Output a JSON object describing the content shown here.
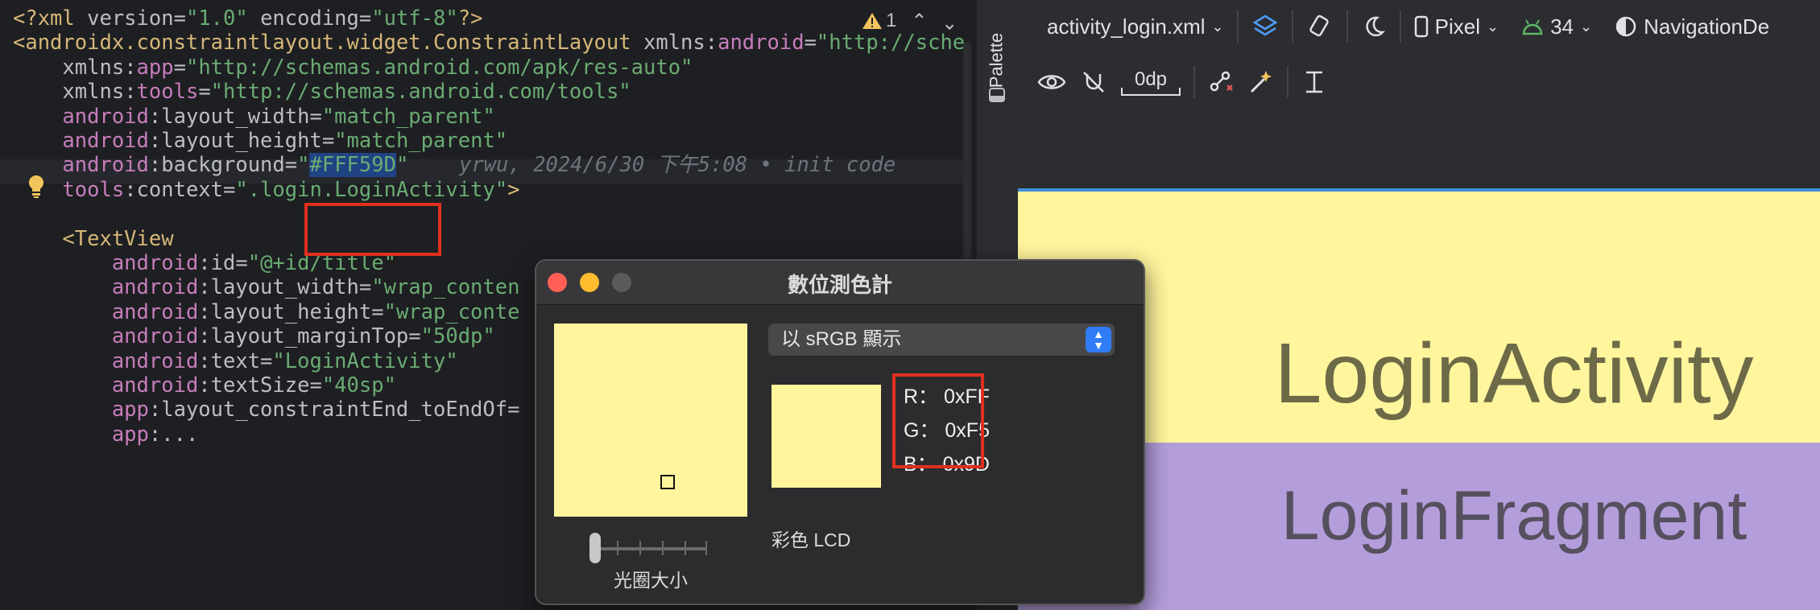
{
  "editor": {
    "lines": [
      {
        "parts": [
          [
            "tag",
            "<?xml "
          ],
          [
            "attr",
            "version"
          ],
          [
            "attr",
            "="
          ],
          [
            "str",
            "\"1.0\""
          ],
          [
            "attr",
            " encoding"
          ],
          [
            "attr",
            "="
          ],
          [
            "str",
            "\"utf-8\""
          ],
          [
            "tag",
            "?>"
          ]
        ]
      },
      {
        "parts": [
          [
            "tag",
            "<androidx.constraintlayout.widget.ConstraintLayout "
          ],
          [
            "attr",
            "xmlns"
          ],
          [
            "attr",
            ":"
          ],
          [
            "ns",
            "android"
          ],
          [
            "attr",
            "="
          ],
          [
            "str",
            "\"http://sche"
          ]
        ]
      },
      {
        "parts": [
          [
            "attr",
            "    "
          ],
          [
            "attr",
            "xmlns"
          ],
          [
            "attr",
            ":"
          ],
          [
            "ns",
            "app"
          ],
          [
            "attr",
            "="
          ],
          [
            "str",
            "\"http://schemas.android.com/apk/res-auto\""
          ]
        ]
      },
      {
        "parts": [
          [
            "attr",
            "    "
          ],
          [
            "attr",
            "xmlns"
          ],
          [
            "attr",
            ":"
          ],
          [
            "ns",
            "tools"
          ],
          [
            "attr",
            "="
          ],
          [
            "str",
            "\"http://schemas.android.com/tools\""
          ]
        ]
      },
      {
        "parts": [
          [
            "attr",
            "    "
          ],
          [
            "ns",
            "android"
          ],
          [
            "attr",
            ":layout_width="
          ],
          [
            "str",
            "\"match_parent\""
          ]
        ]
      },
      {
        "parts": [
          [
            "attr",
            "    "
          ],
          [
            "ns",
            "android"
          ],
          [
            "attr",
            ":layout_height="
          ],
          [
            "str",
            "\"match_parent\""
          ]
        ]
      },
      {
        "parts": [
          [
            "attr",
            "    "
          ],
          [
            "ns",
            "android"
          ],
          [
            "attr",
            ":background="
          ],
          [
            "str",
            "\""
          ],
          [
            "sel",
            "#FFF59D"
          ],
          [
            "str",
            "\""
          ]
        ],
        "highlight": true
      },
      {
        "parts": [
          [
            "attr",
            "    "
          ],
          [
            "ns",
            "tools"
          ],
          [
            "attr",
            ":context="
          ],
          [
            "str",
            "\".login.LoginActivity\""
          ],
          [
            "tag",
            ">"
          ]
        ]
      },
      {
        "parts": []
      },
      {
        "parts": [
          [
            "attr",
            "    "
          ],
          [
            "tag",
            "<TextView"
          ]
        ]
      },
      {
        "parts": [
          [
            "attr",
            "        "
          ],
          [
            "ns",
            "android"
          ],
          [
            "attr",
            ":id="
          ],
          [
            "str",
            "\"@+id/title\""
          ]
        ]
      },
      {
        "parts": [
          [
            "attr",
            "        "
          ],
          [
            "ns",
            "android"
          ],
          [
            "attr",
            ":layout_width="
          ],
          [
            "str",
            "\"wrap_conten"
          ]
        ]
      },
      {
        "parts": [
          [
            "attr",
            "        "
          ],
          [
            "ns",
            "android"
          ],
          [
            "attr",
            ":layout_height="
          ],
          [
            "str",
            "\"wrap_conte"
          ]
        ]
      },
      {
        "parts": [
          [
            "attr",
            "        "
          ],
          [
            "ns",
            "android"
          ],
          [
            "attr",
            ":layout_marginTop="
          ],
          [
            "str",
            "\"50dp\""
          ]
        ]
      },
      {
        "parts": [
          [
            "attr",
            "        "
          ],
          [
            "ns",
            "android"
          ],
          [
            "attr",
            ":text="
          ],
          [
            "str",
            "\"LoginActivity\""
          ]
        ]
      },
      {
        "parts": [
          [
            "attr",
            "        "
          ],
          [
            "ns",
            "android"
          ],
          [
            "attr",
            ":textSize="
          ],
          [
            "str",
            "\"40sp\""
          ]
        ]
      },
      {
        "parts": [
          [
            "attr",
            "        "
          ],
          [
            "ns",
            "app"
          ],
          [
            "attr",
            ":layout_constraintEnd_toEndOf="
          ]
        ]
      },
      {
        "parts": [
          [
            "attr",
            "        "
          ],
          [
            "ns",
            "app"
          ],
          [
            "attr",
            ":..."
          ]
        ]
      }
    ],
    "blame": "yrwu, 2024/6/30 下午5:08 • init code",
    "warning_count": "1"
  },
  "palette_label": "Palette",
  "toolbar": {
    "file": "activity_login.xml",
    "device": "Pixel",
    "api": "34",
    "theme": "NavigationDe",
    "margin": "0dp"
  },
  "preview": {
    "activity_text": "LoginActivity",
    "fragment_text": "LoginFragment",
    "background_color": "#FFF59D",
    "fragment_color": "#B39DDB"
  },
  "color_meter": {
    "title": "數位測色計",
    "display_mode": "以 sRGB 顯示",
    "lcd_label": "彩色 LCD",
    "aperture_label": "光圈大小",
    "r": "R： 0xFF",
    "g": "G： 0xF5",
    "b": "B： 0x9D"
  }
}
